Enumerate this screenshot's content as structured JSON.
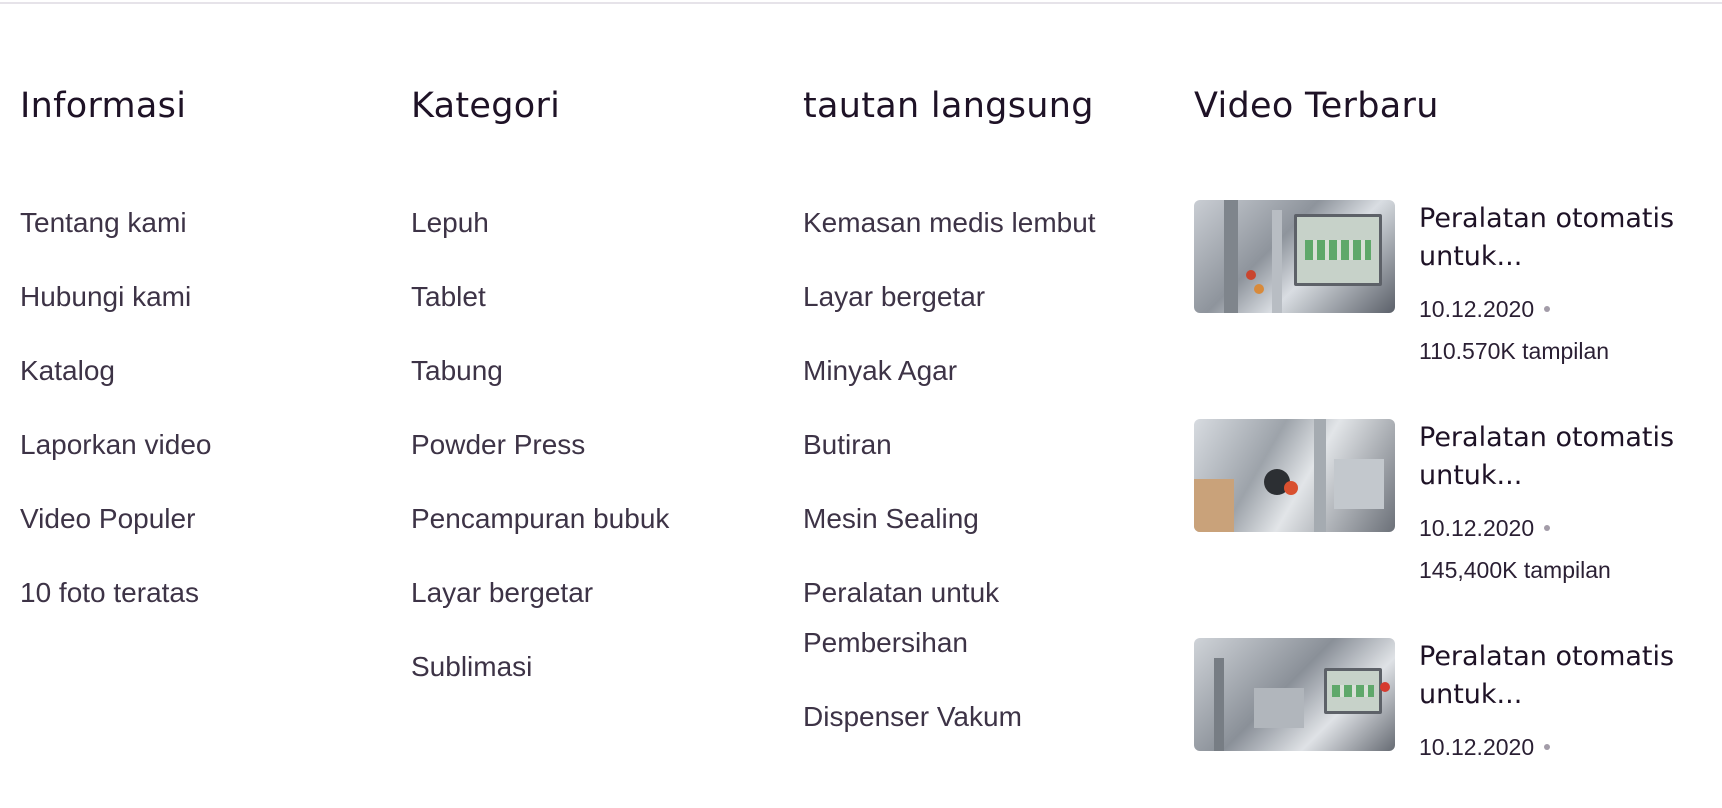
{
  "columns": [
    {
      "title": "Informasi",
      "links": [
        "Tentang kami",
        "Hubungi kami",
        "Katalog",
        "Laporkan video",
        "Video Populer",
        "10 foto teratas"
      ]
    },
    {
      "title": "Kategori",
      "links": [
        "Lepuh",
        "Tablet",
        "Tabung",
        "Powder Press",
        "Pencampuran bubuk",
        "Layar bergetar",
        "Sublimasi"
      ]
    },
    {
      "title": "tautan langsung",
      "links": [
        "Kemasan medis lembut",
        "Layar bergetar",
        "Minyak Agar",
        "Butiran",
        "Mesin Sealing",
        "Peralatan untuk Pembersihan",
        "Dispenser Vakum"
      ]
    }
  ],
  "videos": {
    "title": "Video Terbaru",
    "items": [
      {
        "title": "Peralatan otomatis untuk...",
        "date": "10.12.2020",
        "views": "110.570K tampilan"
      },
      {
        "title": "Peralatan otomatis untuk...",
        "date": "10.12.2020",
        "views": "145,400K tampilan"
      },
      {
        "title": "Peralatan otomatis untuk...",
        "date": "10.12.2020",
        "views": ""
      }
    ]
  }
}
